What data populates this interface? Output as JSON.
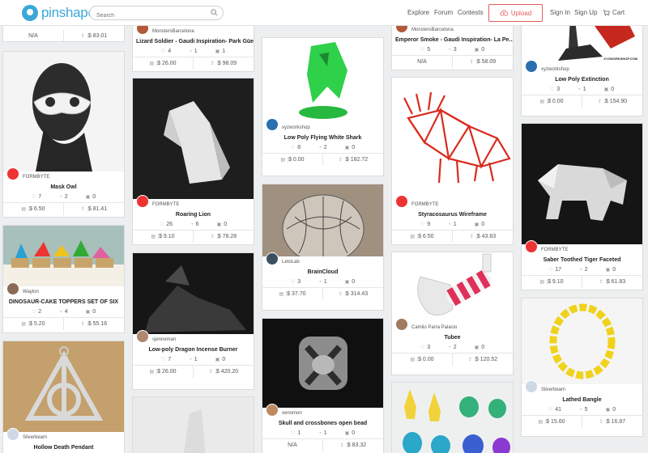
{
  "header": {
    "logo": "pinshape",
    "search_placeholder": "Search",
    "nav": [
      "Explore",
      "Forum",
      "Contests"
    ],
    "upload": "Upload",
    "sign_in": "Sign In",
    "sign_up": "Sign Up",
    "cart": "Cart"
  },
  "colors": {
    "accent": "#3ba8d9",
    "upload": "#e35c5c"
  },
  "col1": {
    "top": {
      "digital": "N/A",
      "print": "$ 83.01"
    },
    "mask_owl": {
      "owner": "FORMBYTE",
      "title": "Mask Owl",
      "likes": "7",
      "comments": "2",
      "makes": "0",
      "digital": "$ 6.50",
      "print": "$ 81.41"
    },
    "dino_toppers": {
      "owner": "Waylon",
      "title": "DINOSAUR-CAKE TOPPERS SET OF SIX",
      "likes": "2",
      "comments": "4",
      "makes": "0",
      "digital": "$ 5.20",
      "print": "$ 55.16"
    },
    "hollow_death": {
      "owner": "Silverbeam",
      "title": "Hollow Death Pendant"
    }
  },
  "col2": {
    "lizard": {
      "owner": "MonstersBarcelona",
      "title": "Lizard Soldier - Gaudi Inspiration- Park Güell",
      "likes": "4",
      "comments": "1",
      "makes": "1",
      "digital": "$ 26.00",
      "print": "$ 98.09"
    },
    "lion": {
      "owner": "FORMBYTE",
      "title": "Roaring Lion",
      "likes": "26",
      "comments": "6",
      "makes": "0",
      "digital": "$ 9.10",
      "print": "$ 78.28"
    },
    "dragon": {
      "owner": "sjenneman",
      "title": "Low-poly Dragon Incense Burner",
      "likes": "7",
      "comments": "1",
      "makes": "0",
      "digital": "$ 26.00",
      "print": "$ 420.20"
    }
  },
  "col3": {
    "shark": {
      "owner": "xyzworkshop",
      "title": "Low Poly Flying White Shark",
      "likes": "8",
      "comments": "2",
      "makes": "0",
      "digital": "$ 0.00",
      "print": "$ 182.72"
    },
    "brain": {
      "owner": "LetoLab",
      "title": "BrainCloud",
      "likes": "3",
      "comments": "1",
      "makes": "0",
      "digital": "$ 37.70",
      "print": "$ 314.43"
    },
    "skull": {
      "owner": "xenomon",
      "title": "Skull and crossbones open bead",
      "likes": "1",
      "comments": "1",
      "makes": "0",
      "digital": "N/A",
      "print": "$ 83.32"
    }
  },
  "col4": {
    "emperor": {
      "owner": "MonstersBarcelona",
      "title": "Emperor Smoke - Gaudi Inspiration- La Pe...",
      "likes": "5",
      "comments": "3",
      "makes": "0",
      "digital": "N/A",
      "print": "$ 58.09"
    },
    "styraco": {
      "owner": "FORMBYTE",
      "title": "Styracosaurus Wireframe",
      "likes": "9",
      "comments": "1",
      "makes": "0",
      "digital": "$ 6.50",
      "print": "$ 43.63"
    },
    "tubee": {
      "owner": "Camilo Parra Palacio",
      "title": "Tubee",
      "likes": "3",
      "comments": "2",
      "makes": "0",
      "digital": "$ 0.00",
      "print": "$ 120.52"
    }
  },
  "col5": {
    "extinction": {
      "owner": "xyzworkshop",
      "title": "Low Poly Extinction",
      "likes": "3",
      "comments": "1",
      "makes": "0",
      "digital": "$ 0.00",
      "print": "$ 154.90",
      "watermark": "XYZWORKSHOP.COM"
    },
    "tiger": {
      "owner": "FORMBYTE",
      "title": "Saber Toothed Tiger Faceted",
      "likes": "17",
      "comments": "2",
      "makes": "0",
      "digital": "$ 9.10",
      "print": "$ 61.83"
    },
    "bangle": {
      "owner": "Silverbeam",
      "title": "Lathed Bangle",
      "likes": "41",
      "comments": "5",
      "makes": "0",
      "digital": "$ 15.60",
      "print": "$ 16.87"
    }
  }
}
